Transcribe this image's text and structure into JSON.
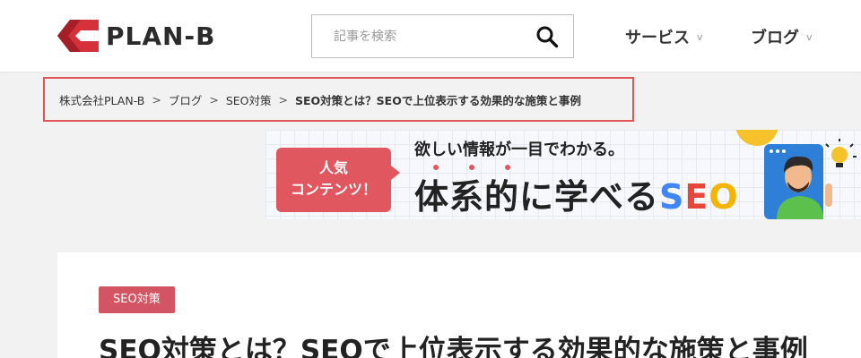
{
  "header": {
    "logo_text": "PLAN-B",
    "search": {
      "placeholder": "記事を検索"
    },
    "nav": [
      {
        "label": "サービス"
      },
      {
        "label": "ブログ"
      }
    ],
    "chevron": "v"
  },
  "breadcrumb": {
    "items": [
      "株式会社PLAN-B",
      "ブログ",
      "SEO対策"
    ],
    "current": "SEO対策とは？SEOで上位表示する効果的な施策と事例",
    "separator": ">"
  },
  "banner": {
    "badge_line1": "人気",
    "badge_line2": "コンテンツ！",
    "subtitle": "欲しい情報が一目でわかる。",
    "title_prefix": "体系的に学べる",
    "title_s": "S",
    "title_e": "E",
    "title_o": "O"
  },
  "article": {
    "category": "SEO対策",
    "title": "SEO対策とは？SEOで上位表示する効果的な施策と事例"
  },
  "colors": {
    "brand_red": "#d6303a",
    "breadcrumb_border": "#e05656",
    "badge": "#e05760",
    "category_tag": "#d35463",
    "seo_s": "#4285f4",
    "seo_e": "#e8463b",
    "seo_o": "#f5b400"
  }
}
